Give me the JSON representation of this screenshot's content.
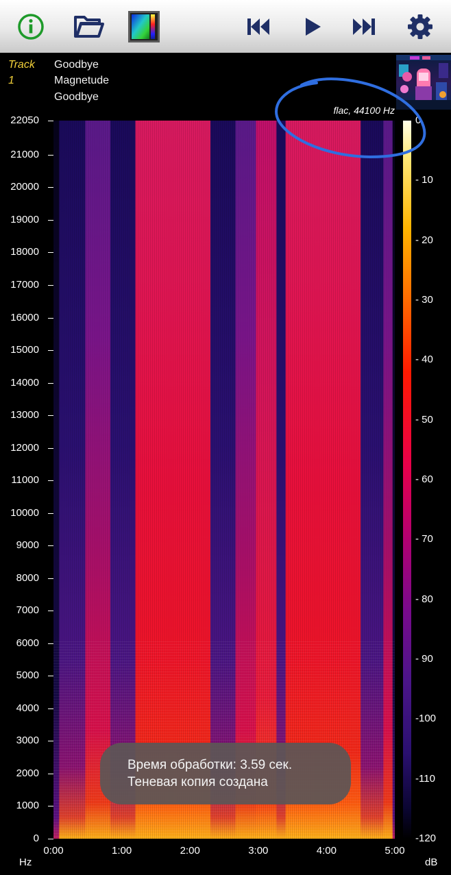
{
  "toolbar": {
    "buttons": [
      {
        "name": "info",
        "icon": "info-icon"
      },
      {
        "name": "open",
        "icon": "folder-open-icon"
      },
      {
        "name": "palette",
        "icon": "spectrogram-palette-icon"
      },
      {
        "name": "previous",
        "icon": "skip-previous-icon"
      },
      {
        "name": "play",
        "icon": "play-icon"
      },
      {
        "name": "next",
        "icon": "skip-next-icon"
      },
      {
        "name": "settings",
        "icon": "gear-icon"
      }
    ],
    "colors": {
      "info": "#1e9a2a",
      "controls": "#1f2f66",
      "background": "#e6e6e6"
    }
  },
  "track": {
    "label": "Track",
    "number": "1",
    "title": "Goodbye",
    "artist": "Magnetude",
    "album": "Goodbye"
  },
  "audio": {
    "format_label": "flac, 44100 Hz"
  },
  "chart_data": {
    "type": "heatmap",
    "title": "",
    "x_axis": {
      "unit": "",
      "ticks": [
        "0:00",
        "1:00",
        "2:00",
        "3:00",
        "4:00",
        "5:00"
      ],
      "range_seconds": [
        0,
        300
      ]
    },
    "y_axis": {
      "unit": "Hz",
      "ticks": [
        "22050",
        "21000",
        "20000",
        "19000",
        "18000",
        "17000",
        "16000",
        "15000",
        "14000",
        "13000",
        "12000",
        "11000",
        "10000",
        "9000",
        "8000",
        "7000",
        "6000",
        "5000",
        "4000",
        "3000",
        "2000",
        "1000",
        "0"
      ],
      "range": [
        0,
        22050
      ]
    },
    "colorbar": {
      "unit": "dB",
      "ticks": [
        "0",
        "- 10",
        "- 20",
        "- 30",
        "- 40",
        "- 50",
        "- 60",
        "- 70",
        "- 80",
        "- 90",
        "-100",
        "-110",
        "-120"
      ],
      "range": [
        -120,
        0
      ],
      "colors": [
        "#fffee8",
        "#ffb400",
        "#ff1a00",
        "#e8004a",
        "#7a0a8c",
        "#2a1070",
        "#000000"
      ]
    },
    "segments_seconds": [
      {
        "start": 0,
        "end": 5,
        "level": "quiet"
      },
      {
        "start": 5,
        "end": 28,
        "level": "low"
      },
      {
        "start": 28,
        "end": 50,
        "level": "mid"
      },
      {
        "start": 50,
        "end": 72,
        "level": "low"
      },
      {
        "start": 72,
        "end": 138,
        "level": "loud"
      },
      {
        "start": 138,
        "end": 160,
        "level": "low"
      },
      {
        "start": 160,
        "end": 178,
        "level": "mid"
      },
      {
        "start": 178,
        "end": 196,
        "level": "mid-loud"
      },
      {
        "start": 196,
        "end": 204,
        "level": "low"
      },
      {
        "start": 204,
        "end": 270,
        "level": "loud"
      },
      {
        "start": 270,
        "end": 290,
        "level": "low"
      },
      {
        "start": 290,
        "end": 298,
        "level": "mid"
      },
      {
        "start": 298,
        "end": 300,
        "level": "quiet"
      }
    ]
  },
  "toast": {
    "line1": "Время обработки: 3.59 сек.",
    "line2": "Теневая копия создана"
  }
}
